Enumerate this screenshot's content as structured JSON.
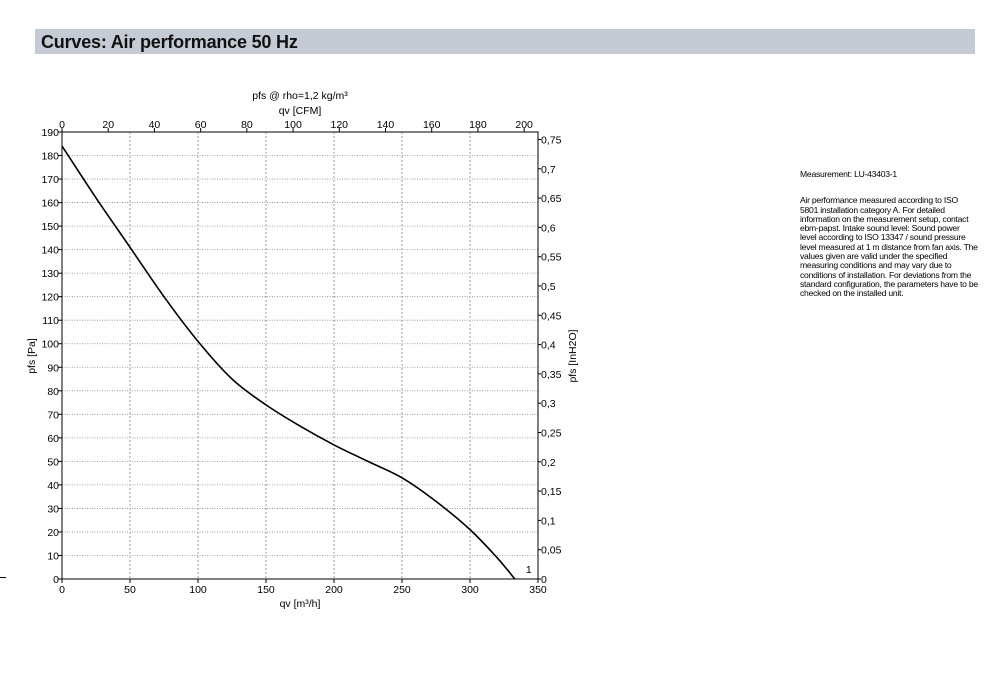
{
  "header": {
    "title": "Curves: Air performance 50 Hz"
  },
  "side_notes": {
    "measurement": "Measurement: LU-43403-1",
    "description": "Air performance measured according to ISO 5801 installation category A. For detailed information on the measurement setup, contact ebm-papst. Intake sound level: Sound power level according to ISO 13347 / sound pressure level measured at 1 m distance from fan axis. The values given are valid under the specified measuring conditions and may vary due to conditions of installation. For deviations from the standard configuration, the parameters have to be checked on the installed unit."
  },
  "chart_data": {
    "type": "line",
    "top_title": "pfs @ rho=1,2 kg/m³",
    "xlabel": "qv [m³/h]",
    "x2label": "qv [CFM]",
    "ylabel": "pfs [Pa]",
    "y2label": "pfs [InH2O]",
    "xlim": [
      0,
      350
    ],
    "ylim": [
      0,
      190
    ],
    "x_ticks": [
      "0",
      "50",
      "100",
      "150",
      "200",
      "250",
      "300",
      "350"
    ],
    "x2_ticks": [
      "0",
      "20",
      "40",
      "60",
      "80",
      "100",
      "120",
      "140",
      "160",
      "180",
      "200"
    ],
    "y_ticks": [
      "0",
      "10",
      "20",
      "30",
      "40",
      "50",
      "60",
      "70",
      "80",
      "90",
      "100",
      "110",
      "120",
      "130",
      "140",
      "150",
      "160",
      "170",
      "180",
      "190"
    ],
    "y2_ticks": [
      "0",
      "0,05",
      "0,1",
      "0,15",
      "0,2",
      "0,25",
      "0,3",
      "0,35",
      "0,4",
      "0,45",
      "0,5",
      "0,55",
      "0,6",
      "0,65",
      "0,7",
      "0,75"
    ],
    "grid": true,
    "series": [
      {
        "name": "1",
        "x": [
          0,
          25,
          50,
          75,
          100,
          125,
          150,
          175,
          200,
          225,
          250,
          275,
          300,
          320,
          333
        ],
        "y": [
          184,
          162,
          141,
          120,
          101,
          85,
          74,
          65,
          57,
          50,
          43,
          33,
          21,
          9,
          0
        ]
      }
    ]
  }
}
